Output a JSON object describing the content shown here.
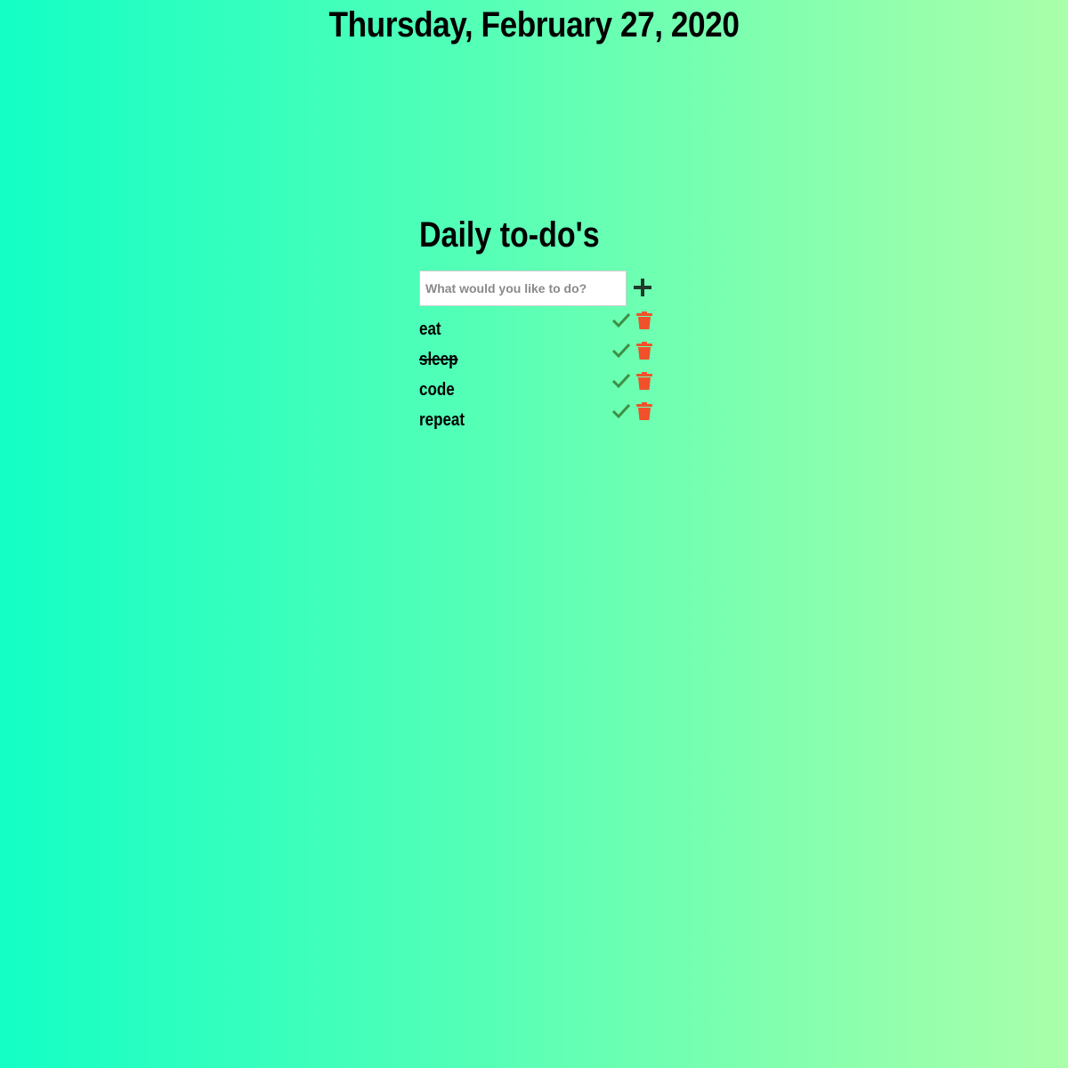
{
  "date_heading": "Thursday, February 27, 2020",
  "todo": {
    "title": "Daily to-do's",
    "input": {
      "placeholder": "What would you like to do?",
      "value": ""
    },
    "add_icon": "plus-icon",
    "items": [
      {
        "text": "eat",
        "completed": false,
        "check_icon": "check-icon",
        "delete_icon": "trash-icon"
      },
      {
        "text": "sleep",
        "completed": true,
        "check_icon": "check-icon",
        "delete_icon": "trash-icon"
      },
      {
        "text": "code",
        "completed": false,
        "check_icon": "check-icon",
        "delete_icon": "trash-icon"
      },
      {
        "text": "repeat",
        "completed": false,
        "check_icon": "check-icon",
        "delete_icon": "trash-icon"
      }
    ]
  },
  "colors": {
    "background_start": "#13ffc5",
    "background_end": "#aaffaa",
    "check": "#3c8f44",
    "trash": "#f0512a",
    "plus": "#1f3a2a"
  }
}
